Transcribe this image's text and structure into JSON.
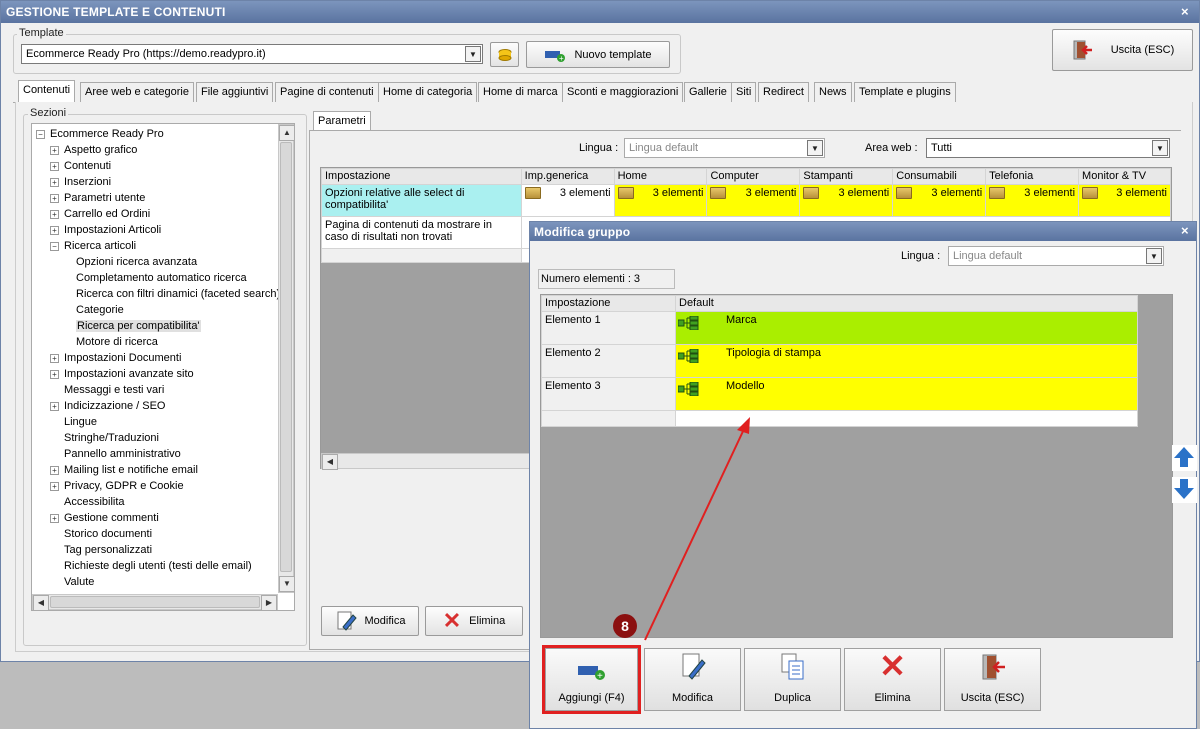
{
  "window": {
    "title": "GESTIONE TEMPLATE E CONTENUTI",
    "close": "×"
  },
  "template": {
    "label": "Template",
    "value": "Ecommerce Ready Pro (https://demo.readypro.it)",
    "new_button": "Nuovo template",
    "exit_button": "Uscita (ESC)"
  },
  "tabs": [
    "Contenuti",
    "Aree web e categorie",
    "File aggiuntivi",
    "Pagine di contenuti",
    "Home di categoria",
    "Home di marca",
    "Sconti e maggiorazioni",
    "Gallerie",
    "Siti",
    "Redirect",
    "News",
    "Template e plugins"
  ],
  "sections": {
    "label": "Sezioni",
    "root": "Ecommerce Ready Pro",
    "items": [
      {
        "label": "Aspetto grafico",
        "plus": true,
        "level": 1
      },
      {
        "label": "Contenuti",
        "plus": true,
        "level": 1
      },
      {
        "label": "Inserzioni",
        "plus": true,
        "level": 1
      },
      {
        "label": "Parametri utente",
        "plus": true,
        "level": 1
      },
      {
        "label": "Carrello ed Ordini",
        "plus": true,
        "level": 1
      },
      {
        "label": "Impostazioni Articoli",
        "plus": true,
        "level": 1
      },
      {
        "label": "Ricerca articoli",
        "plus": true,
        "level": 1,
        "expanded": true
      },
      {
        "label": "Opzioni ricerca avanzata",
        "plus": false,
        "level": 2
      },
      {
        "label": "Completamento automatico ricerca",
        "plus": false,
        "level": 2
      },
      {
        "label": "Ricerca con filtri dinamici (faceted search)",
        "plus": false,
        "level": 2
      },
      {
        "label": "Categorie",
        "plus": false,
        "level": 2
      },
      {
        "label": "Ricerca per compatibilita'",
        "plus": false,
        "level": 2,
        "selected": true
      },
      {
        "label": "Motore di ricerca",
        "plus": false,
        "level": 2
      },
      {
        "label": "Impostazioni Documenti",
        "plus": true,
        "level": 1
      },
      {
        "label": "Impostazioni avanzate sito",
        "plus": true,
        "level": 1
      },
      {
        "label": "Messaggi e testi vari",
        "plus": false,
        "level": 1
      },
      {
        "label": "Indicizzazione / SEO",
        "plus": true,
        "level": 1
      },
      {
        "label": "Lingue",
        "plus": false,
        "level": 1
      },
      {
        "label": "Stringhe/Traduzioni",
        "plus": false,
        "level": 1
      },
      {
        "label": "Pannello amministrativo",
        "plus": false,
        "level": 1
      },
      {
        "label": "Mailing list e notifiche email",
        "plus": true,
        "level": 1
      },
      {
        "label": "Privacy, GDPR e Cookie",
        "plus": true,
        "level": 1
      },
      {
        "label": "Accessibilita",
        "plus": false,
        "level": 1
      },
      {
        "label": "Gestione commenti",
        "plus": true,
        "level": 1
      },
      {
        "label": "Storico documenti",
        "plus": false,
        "level": 1
      },
      {
        "label": "Tag personalizzati",
        "plus": false,
        "level": 1
      },
      {
        "label": "Richieste degli utenti (testi delle email)",
        "plus": false,
        "level": 1
      },
      {
        "label": "Valute",
        "plus": false,
        "level": 1
      }
    ]
  },
  "params": {
    "tab": "Parametri",
    "lingua_label": "Lingua :",
    "lingua_value": "Lingua default",
    "area_label": "Area web :",
    "area_value": "Tutti",
    "columns": [
      "Impostazione",
      "Imp.generica",
      "Home",
      "Computer",
      "Stampanti",
      "Consumabili",
      "Telefonia",
      "Monitor & TV"
    ],
    "row1_label": "Opzioni relative alle select di compatibilita'",
    "row1_value": "3 elementi",
    "row2_label": "Pagina di contenuti da mostrare in caso di risultati non trovati",
    "modify_button": "Modifica",
    "delete_button": "Elimina"
  },
  "dialog": {
    "title": "Modifica gruppo",
    "close": "×",
    "lingua_label": "Lingua :",
    "lingua_value": "Lingua default",
    "count": "Numero elementi : 3",
    "col_setting": "Impostazione",
    "col_default": "Default",
    "rows": [
      {
        "name": "Elemento 1",
        "value": "Marca"
      },
      {
        "name": "Elemento 2",
        "value": "Tipologia di stampa"
      },
      {
        "name": "Elemento 3",
        "value": "Modello"
      }
    ],
    "buttons": {
      "add": "Aggiungi (F4)",
      "modify": "Modifica",
      "duplicate": "Duplica",
      "delete": "Elimina",
      "exit": "Uscita (ESC)"
    },
    "step": "8"
  },
  "colors": {
    "title": "#6a84ae",
    "yellow": "#ffff00",
    "green": "#aaee00",
    "cyan": "#aaf0f0",
    "highlight": "#e02020"
  }
}
